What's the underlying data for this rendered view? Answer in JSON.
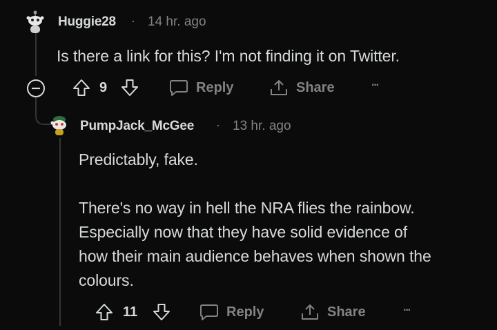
{
  "comments": [
    {
      "username": "Huggie28",
      "separator": "·",
      "timestamp": "14 hr. ago",
      "body": [
        "Is there a link for this? I'm not finding it on Twitter."
      ],
      "votes": "9",
      "reply_label": "Reply",
      "share_label": "Share",
      "more_label": "···"
    },
    {
      "username": "PumpJack_McGee",
      "separator": "·",
      "timestamp": "13 hr. ago",
      "body": [
        "Predictably, fake.",
        "There's no way in hell the NRA flies the rainbow.",
        "Especially now that they have solid evidence of",
        "how their main audience behaves when shown the",
        "colours."
      ],
      "votes": "11",
      "reply_label": "Reply",
      "share_label": "Share",
      "more_label": "···"
    }
  ],
  "icons": {
    "avatar1": "snoo-avatar-icon",
    "avatar2": "snoo-avatar-icon",
    "collapse": "collapse-minus-icon",
    "upvote": "upvote-arrow-icon",
    "downvote": "downvote-arrow-icon",
    "reply": "speech-bubble-icon",
    "share": "share-icon",
    "more": "more-dots-icon"
  },
  "colors": {
    "background": "#0b0b0b",
    "text": "#d7dadc",
    "muted": "#818384",
    "thread_line": "#343536"
  }
}
